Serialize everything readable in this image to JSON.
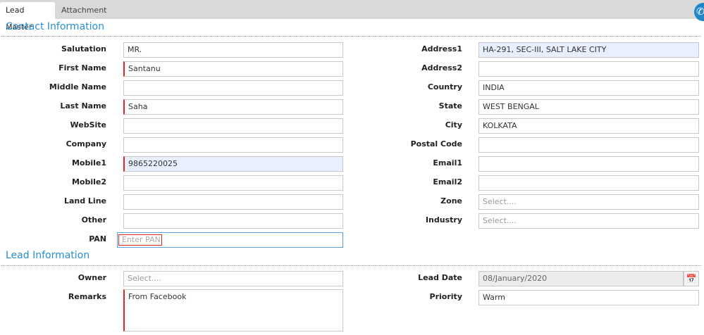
{
  "tabs": {
    "lead_master": "Lead Master",
    "attachment": "Attachment"
  },
  "sections": {
    "contact": "Contact Information",
    "lead": "Lead Information"
  },
  "contact_left": {
    "salutation": {
      "label": "Salutation",
      "value": "MR."
    },
    "first_name": {
      "label": "First Name",
      "value": "Santanu"
    },
    "middle_name": {
      "label": "Middle Name",
      "value": ""
    },
    "last_name": {
      "label": "Last Name",
      "value": "Saha"
    },
    "website": {
      "label": "WebSite",
      "value": ""
    },
    "company": {
      "label": "Company",
      "value": ""
    },
    "mobile1": {
      "label": "Mobile1",
      "value": "9865220025"
    },
    "mobile2": {
      "label": "Mobile2",
      "value": ""
    },
    "landline": {
      "label": "Land Line",
      "value": ""
    },
    "other": {
      "label": "Other",
      "value": ""
    },
    "pan": {
      "label": "PAN",
      "placeholder": "Enter PAN"
    }
  },
  "contact_right": {
    "address1": {
      "label": "Address1",
      "value": "HA-291, SEC-III, SALT LAKE CITY"
    },
    "address2": {
      "label": "Address2",
      "value": ""
    },
    "country": {
      "label": "Country",
      "value": "INDIA"
    },
    "state": {
      "label": "State",
      "value": "WEST BENGAL"
    },
    "city": {
      "label": "City",
      "value": "KOLKATA"
    },
    "postal_code": {
      "label": "Postal Code",
      "value": ""
    },
    "email1": {
      "label": "Email1",
      "value": ""
    },
    "email2": {
      "label": "Email2",
      "value": ""
    },
    "zone": {
      "label": "Zone",
      "placeholder": "Select...."
    },
    "industry": {
      "label": "Industry",
      "placeholder": "Select...."
    }
  },
  "lead": {
    "owner": {
      "label": "Owner",
      "placeholder": "Select...."
    },
    "remarks": {
      "label": "Remarks",
      "value": "From Facebook"
    },
    "lead_date": {
      "label": "Lead Date",
      "value": "08/January/2020"
    },
    "priority": {
      "label": "Priority",
      "value": "Warm"
    }
  },
  "icons": {
    "phone": "phone-icon",
    "calendar": "calendar-icon"
  },
  "colors": {
    "accent": "#2a8fd0",
    "required": "#e2261c",
    "highlight": "#e9efff"
  }
}
